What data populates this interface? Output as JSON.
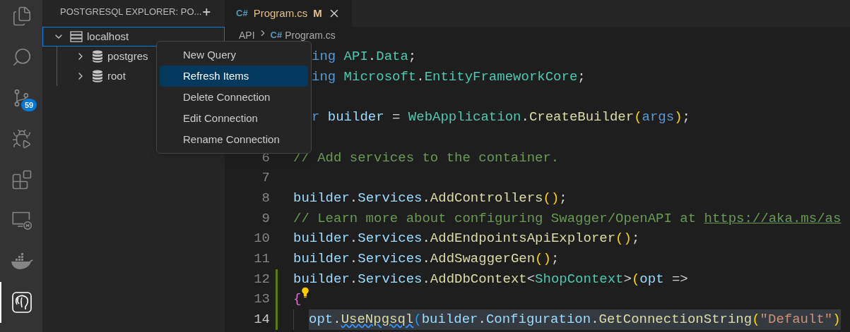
{
  "activity_bar": [
    {
      "kind": "files",
      "selected": false
    },
    {
      "kind": "search",
      "selected": false
    },
    {
      "kind": "source-control",
      "selected": false,
      "badge": "59"
    },
    {
      "kind": "run-debug",
      "selected": false
    },
    {
      "kind": "extensions",
      "selected": false
    },
    {
      "kind": "remote",
      "selected": false
    },
    {
      "kind": "docker",
      "selected": false
    },
    {
      "kind": "postgres",
      "selected": true
    }
  ],
  "sidebar": {
    "title": "POSTGRESQL EXPLORER: PO...",
    "tree": [
      {
        "label": "localhost",
        "kind": "server",
        "expanded": true,
        "focused": true,
        "children": [
          {
            "label": "postgres",
            "kind": "database",
            "expanded": false
          },
          {
            "label": "root",
            "kind": "database",
            "expanded": false
          }
        ]
      }
    ]
  },
  "tabs": [
    {
      "file_icon": "C#",
      "label": "Program.cs",
      "status": "M",
      "modified": true,
      "selected": true
    }
  ],
  "breadcrumb": [
    {
      "label": "API"
    },
    {
      "file_icon": "C#",
      "label": "Program.cs"
    }
  ],
  "code_lines": [
    {
      "clipped": true,
      "tokens": [
        {
          "text": "ing",
          "kind": "keyword"
        },
        {
          "text": " API",
          "kind": "type"
        },
        {
          "text": ".",
          "kind": "plain"
        },
        {
          "text": "Data",
          "kind": "type"
        },
        {
          "text": ";",
          "kind": "plain"
        }
      ]
    },
    {
      "clipped": true,
      "tokens": [
        {
          "text": "ing",
          "kind": "keyword"
        },
        {
          "text": " Microsoft",
          "kind": "type"
        },
        {
          "text": ".",
          "kind": "plain"
        },
        {
          "text": "EntityFrameworkCore",
          "kind": "type"
        },
        {
          "text": ";",
          "kind": "plain"
        }
      ]
    },
    {
      "blank": true
    },
    {
      "clipped": true,
      "tokens": [
        {
          "text": "r",
          "kind": "keyword"
        },
        {
          "text": " builder",
          "kind": "variable"
        },
        {
          "text": " = ",
          "kind": "plain"
        },
        {
          "text": "WebApplication",
          "kind": "type"
        },
        {
          "text": ".",
          "kind": "plain"
        },
        {
          "text": "CreateBuilder",
          "kind": "method"
        },
        {
          "text": "(",
          "kind": "bracket1"
        },
        {
          "text": "args",
          "kind": "keyword"
        },
        {
          "text": ")",
          "kind": "bracket1"
        },
        {
          "text": ";",
          "kind": "plain"
        }
      ]
    },
    {
      "blank": true
    },
    {
      "number": "6",
      "tokens": [
        {
          "text": "// Add services to the container.",
          "kind": "comment"
        }
      ]
    },
    {
      "number": "7"
    },
    {
      "number": "8",
      "tokens": [
        {
          "text": "builder",
          "kind": "variable"
        },
        {
          "text": ".",
          "kind": "plain"
        },
        {
          "text": "Services",
          "kind": "variable"
        },
        {
          "text": ".",
          "kind": "plain"
        },
        {
          "text": "AddControllers",
          "kind": "method"
        },
        {
          "text": "(",
          "kind": "bracket1"
        },
        {
          "text": ")",
          "kind": "bracket1"
        },
        {
          "text": ";",
          "kind": "plain"
        }
      ]
    },
    {
      "number": "9",
      "tokens": [
        {
          "text": "// Learn more about configuring Swagger/OpenAPI at ",
          "kind": "comment"
        },
        {
          "text": "https://aka.ms/as",
          "kind": "link"
        }
      ]
    },
    {
      "number": "10",
      "tokens": [
        {
          "text": "builder",
          "kind": "variable"
        },
        {
          "text": ".",
          "kind": "plain"
        },
        {
          "text": "Services",
          "kind": "variable"
        },
        {
          "text": ".",
          "kind": "plain"
        },
        {
          "text": "AddEndpointsApiExplorer",
          "kind": "method"
        },
        {
          "text": "(",
          "kind": "bracket1"
        },
        {
          "text": ")",
          "kind": "bracket1"
        },
        {
          "text": ";",
          "kind": "plain"
        }
      ]
    },
    {
      "number": "11",
      "tokens": [
        {
          "text": "builder",
          "kind": "variable"
        },
        {
          "text": ".",
          "kind": "plain"
        },
        {
          "text": "Services",
          "kind": "variable"
        },
        {
          "text": ".",
          "kind": "plain"
        },
        {
          "text": "AddSwaggerGen",
          "kind": "method"
        },
        {
          "text": "(",
          "kind": "bracket1"
        },
        {
          "text": ")",
          "kind": "bracket1"
        },
        {
          "text": ";",
          "kind": "plain"
        }
      ]
    },
    {
      "number": "12",
      "modified": true,
      "tokens": [
        {
          "text": "builder",
          "kind": "variable"
        },
        {
          "text": ".",
          "kind": "plain"
        },
        {
          "text": "Services",
          "kind": "variable"
        },
        {
          "text": ".",
          "kind": "plain"
        },
        {
          "text": "AddDbContext",
          "kind": "method"
        },
        {
          "text": "<",
          "kind": "plain"
        },
        {
          "text": "ShopContext",
          "kind": "type"
        },
        {
          "text": ">",
          "kind": "plain"
        },
        {
          "text": "(",
          "kind": "bracket1"
        },
        {
          "text": "opt",
          "kind": "variable"
        },
        {
          "text": " =>",
          "kind": "plain"
        }
      ]
    },
    {
      "number": "13",
      "modified": true,
      "lightbulb": true,
      "tokens": [
        {
          "text": "{",
          "kind": "bracket2"
        }
      ]
    },
    {
      "number": "14",
      "modified": true,
      "current": true,
      "indented": true,
      "highlighted": true,
      "tokens": [
        {
          "text": "opt",
          "kind": "variable"
        },
        {
          "text": ".",
          "kind": "plain"
        },
        {
          "text": "UseNpgsql",
          "kind": "method",
          "squiggle": true
        },
        {
          "text": "(",
          "kind": "bracket3"
        },
        {
          "text": "builder",
          "kind": "variable"
        },
        {
          "text": ".",
          "kind": "plain"
        },
        {
          "text": "Configuration",
          "kind": "variable"
        },
        {
          "text": ".",
          "kind": "plain"
        },
        {
          "text": "GetConnectionString",
          "kind": "method"
        },
        {
          "text": "(",
          "kind": "bracket1"
        },
        {
          "text": "\"Default\"",
          "kind": "string"
        },
        {
          "text": ")",
          "kind": "bracket1"
        }
      ]
    }
  ],
  "context_menu": [
    {
      "label": "New Query",
      "selected": false
    },
    {
      "label": "Refresh Items",
      "selected": true
    },
    {
      "label": "Delete Connection",
      "selected": false
    },
    {
      "label": "Edit Connection",
      "selected": false
    },
    {
      "label": "Rename Connection",
      "selected": false
    }
  ]
}
